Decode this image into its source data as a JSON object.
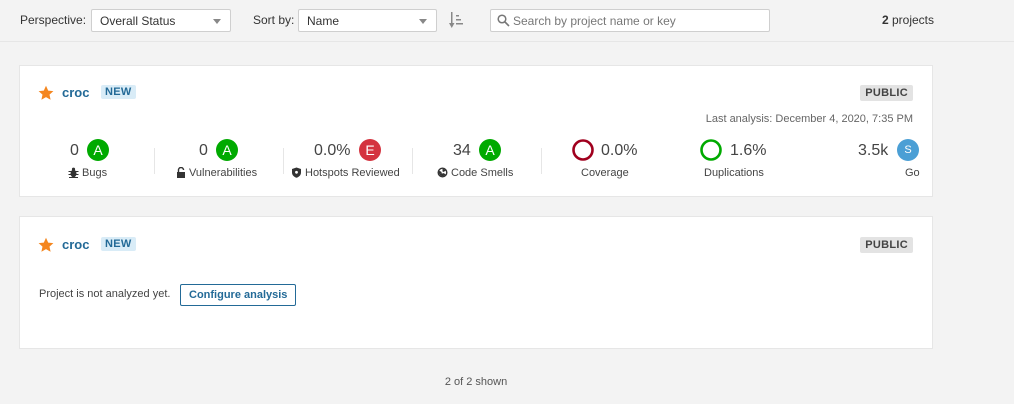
{
  "toolbar": {
    "perspective_label": "Perspective:",
    "perspective_value": "Overall Status",
    "sortby_label": "Sort by:",
    "sortby_value": "Name",
    "search_placeholder": "Search by project name or key",
    "count_value": "2",
    "count_suffix": " projects"
  },
  "projects": [
    {
      "name": "croc",
      "badge": "NEW",
      "visibility": "PUBLIC",
      "last_analysis": "Last analysis: December 4, 2020, 7:35 PM",
      "measures": {
        "bugs": {
          "value": "0",
          "rating": "A",
          "label": "Bugs"
        },
        "vulnerabilities": {
          "value": "0",
          "rating": "A",
          "label": "Vulnerabilities"
        },
        "hotspots": {
          "value": "0.0%",
          "rating": "E",
          "label": "Hotspots Reviewed"
        },
        "code_smells": {
          "value": "34",
          "rating": "A",
          "label": "Code Smells"
        },
        "coverage": {
          "value": "0.0%",
          "label": "Coverage"
        },
        "duplications": {
          "value": "1.6%",
          "label": "Duplications"
        },
        "size": {
          "value": "3.5k",
          "rating": "S",
          "label": "Go"
        }
      },
      "colors": {
        "rating_a": "#00aa00",
        "rating_e": "#d4333f",
        "size": "#4b9fd5",
        "coverage_ring": "#a0001e",
        "duplication_ring": "#00aa00"
      }
    },
    {
      "name": "croc",
      "badge": "NEW",
      "visibility": "PUBLIC",
      "not_analyzed": "Project is not analyzed yet.",
      "configure_label": "Configure analysis"
    }
  ],
  "footer": {
    "shown": "2 of 2 shown"
  },
  "icons": [
    "chevron-down-icon",
    "sort-direction-icon",
    "search-icon",
    "star-icon",
    "bug-icon",
    "lock-icon",
    "shield-icon",
    "radiation-icon"
  ]
}
